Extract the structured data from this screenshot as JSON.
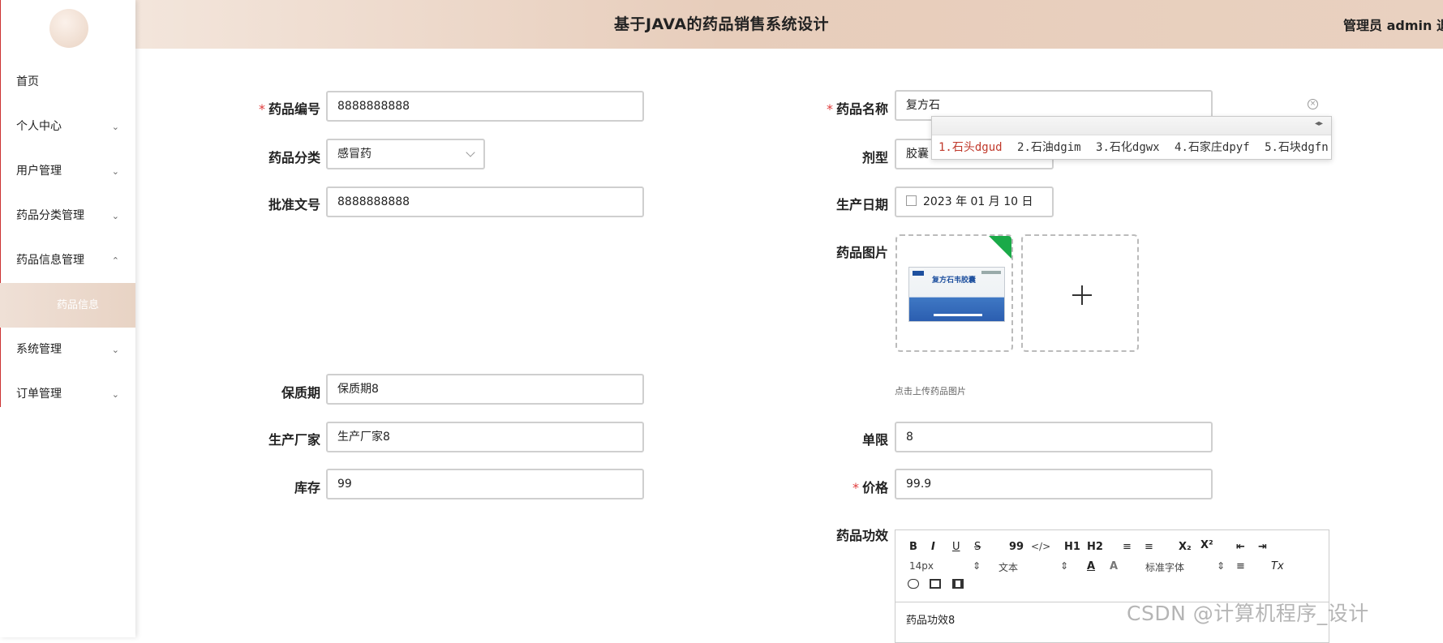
{
  "header": {
    "title": "基于JAVA的药品销售系统设计",
    "user_label": "管理员 admin  退"
  },
  "sidebar": {
    "items": [
      {
        "label": "首页",
        "chevron": ""
      },
      {
        "label": "个人中心",
        "chevron": "⌄"
      },
      {
        "label": "用户管理",
        "chevron": "⌄"
      },
      {
        "label": "药品分类管理",
        "chevron": "⌄"
      },
      {
        "label": "药品信息管理",
        "chevron": "⌃"
      },
      {
        "label": "药品信息",
        "chevron": ""
      },
      {
        "label": "系统管理",
        "chevron": "⌄"
      },
      {
        "label": "订单管理",
        "chevron": "⌄"
      }
    ]
  },
  "form": {
    "required_mark": "*",
    "code": {
      "label": "药品编号",
      "value": "8888888888"
    },
    "name": {
      "label": "药品名称",
      "value": "复方石"
    },
    "category": {
      "label": "药品分类",
      "value": "感冒药"
    },
    "form_type": {
      "label": "剂型",
      "value": "胶囊"
    },
    "approval_no": {
      "label": "批准文号",
      "value": "8888888888"
    },
    "production_date": {
      "label": "生产日期",
      "value": "2023 年 01 月 10 日"
    },
    "image": {
      "label": "药品图片",
      "product_text": "复方石韦胶囊",
      "hint": "点击上传药品图片"
    },
    "shelf_life": {
      "label": "保质期",
      "value": "保质期8"
    },
    "manufacturer": {
      "label": "生产厂家",
      "value": "生产厂家8"
    },
    "limit": {
      "label": "单限",
      "value": "8"
    },
    "stock": {
      "label": "库存",
      "value": "99"
    },
    "price": {
      "label": "价格",
      "value": "99.9"
    },
    "efficacy": {
      "label": "药品功效",
      "content": "药品功效8"
    }
  },
  "ime": {
    "nav_arrows": "◂▸",
    "candidates": [
      "1.石头dgud",
      "2.石油dgim",
      "3.石化dgwx",
      "4.石家庄dpyf",
      "5.石块dgfn"
    ]
  },
  "editor_toolbar": {
    "bold": "B",
    "italic": "I",
    "underline": "U",
    "strike": "S",
    "quote": "99",
    "code": "</>",
    "h1": "H1",
    "h2": "H2",
    "ordered_list": "≡",
    "bullet_list": "≡",
    "subscript": "X₂",
    "superscript": "X²",
    "outdent": "⇤",
    "indent": "⇥",
    "font_size": "14px",
    "text_type": "文本",
    "font_family": "标准字体",
    "font_color": "A",
    "background_color": "A",
    "align": "≡",
    "clear_format": "Tx",
    "select_caret": "⇕"
  },
  "watermark": "CSDN @计算机程序_设计"
}
